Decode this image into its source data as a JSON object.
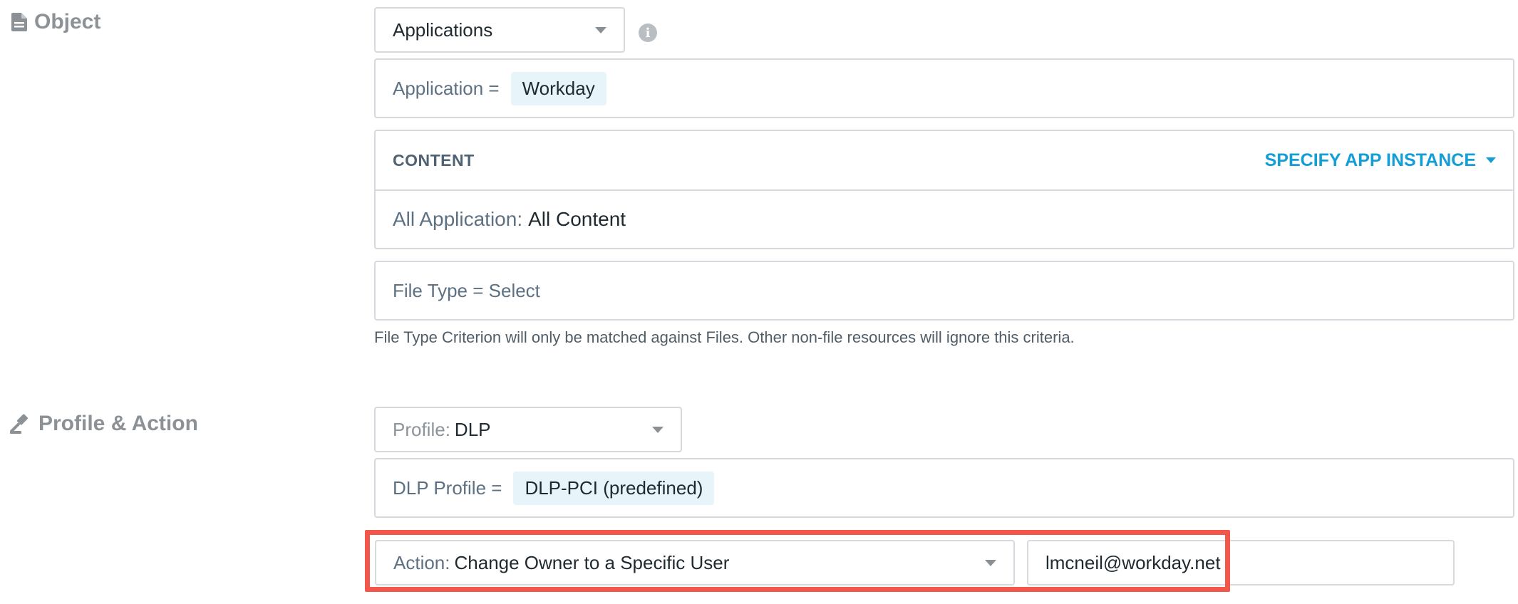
{
  "object_section": {
    "title": "Object",
    "icon": "document-icon",
    "object_select": {
      "value": "Applications"
    },
    "info_icon_glyph": "i",
    "application_filter": {
      "label": "Application =",
      "chip": "Workday"
    },
    "content_panel": {
      "header": "CONTENT",
      "specify_link": "SPECIFY APP INSTANCE",
      "body_label": "All Application:",
      "body_value": "All Content"
    },
    "file_type_filter": {
      "text": "File Type = Select"
    },
    "helper_text": "File Type Criterion will only be matched against Files. Other non-file resources will ignore this criteria."
  },
  "profile_section": {
    "title": "Profile & Action",
    "icon": "gavel-icon",
    "profile_select": {
      "label": "Profile:",
      "value": "DLP"
    },
    "dlp_filter": {
      "label": "DLP Profile =",
      "chip": "DLP-PCI (predefined)"
    },
    "action_select": {
      "label": "Action:",
      "value": "Change Owner to a Specific User"
    },
    "owner_email": {
      "value": "lmcneil@workday.net"
    }
  },
  "colors": {
    "accent": "#139fd6",
    "chip_bg": "#e7f5fb",
    "highlight": "#f3574b",
    "border": "#d6dade"
  }
}
